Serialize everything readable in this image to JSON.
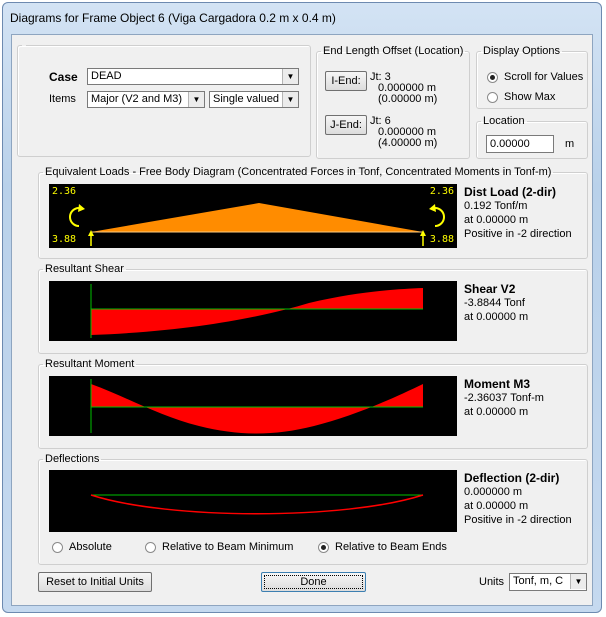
{
  "window": {
    "title": "Diagrams for Frame Object 6  (Viga Cargadora 0.2 m x 0.4 m)"
  },
  "case": {
    "label": "Case",
    "value": "DEAD"
  },
  "items": {
    "label": "Items",
    "value": "Major (V2 and M3)",
    "mode": "Single valued"
  },
  "end_offset": {
    "legend": "End Length Offset (Location)",
    "i_end": {
      "button": "I-End:",
      "jt": "Jt:  3",
      "offset": "0.000000 m",
      "location": "(0.00000 m)"
    },
    "j_end": {
      "button": "J-End:",
      "jt": "Jt:  6",
      "offset": "0.000000 m",
      "location": "(4.00000 m)"
    }
  },
  "display_options": {
    "legend": "Display Options",
    "scroll": "Scroll for Values",
    "show_max": "Show Max",
    "selected": "scroll"
  },
  "location": {
    "legend": "Location",
    "value": "0.00000",
    "unit": "m"
  },
  "loads": {
    "legend": "Equivalent Loads - Free Body Diagram  (Concentrated Forces in Tonf, Concentrated Moments in Tonf-m)",
    "left_moment": "2.36",
    "left_force": "3.88",
    "right_moment": "2.36",
    "right_force": "3.88",
    "title": "Dist Load (2-dir)",
    "value": "0.192 Tonf/m",
    "at": "at 0.00000 m",
    "direction": "Positive in -2 direction"
  },
  "shear": {
    "legend": "Resultant Shear",
    "title": "Shear V2",
    "value": "-3.8844 Tonf",
    "at": "at 0.00000 m"
  },
  "moment": {
    "legend": "Resultant Moment",
    "title": "Moment M3",
    "value": "-2.36037 Tonf-m",
    "at": "at 0.00000 m"
  },
  "deflection": {
    "legend": "Deflections",
    "title": "Deflection (2-dir)",
    "value": "0.000000 m",
    "at": "at 0.00000 m",
    "direction": "Positive in -2 direction",
    "opt_absolute": "Absolute",
    "opt_min": "Relative to Beam Minimum",
    "opt_ends": "Relative to Beam Ends",
    "selected": "ends"
  },
  "footer": {
    "reset": "Reset to Initial Units",
    "done": "Done",
    "units_label": "Units",
    "units_value": "Tonf, m, C"
  },
  "colors": {
    "load_fill": "#ff8c00",
    "diagram_fill": "#ff0000",
    "axis": "#00c000",
    "moment_arrow": "#ffff00",
    "background": "#000000"
  }
}
